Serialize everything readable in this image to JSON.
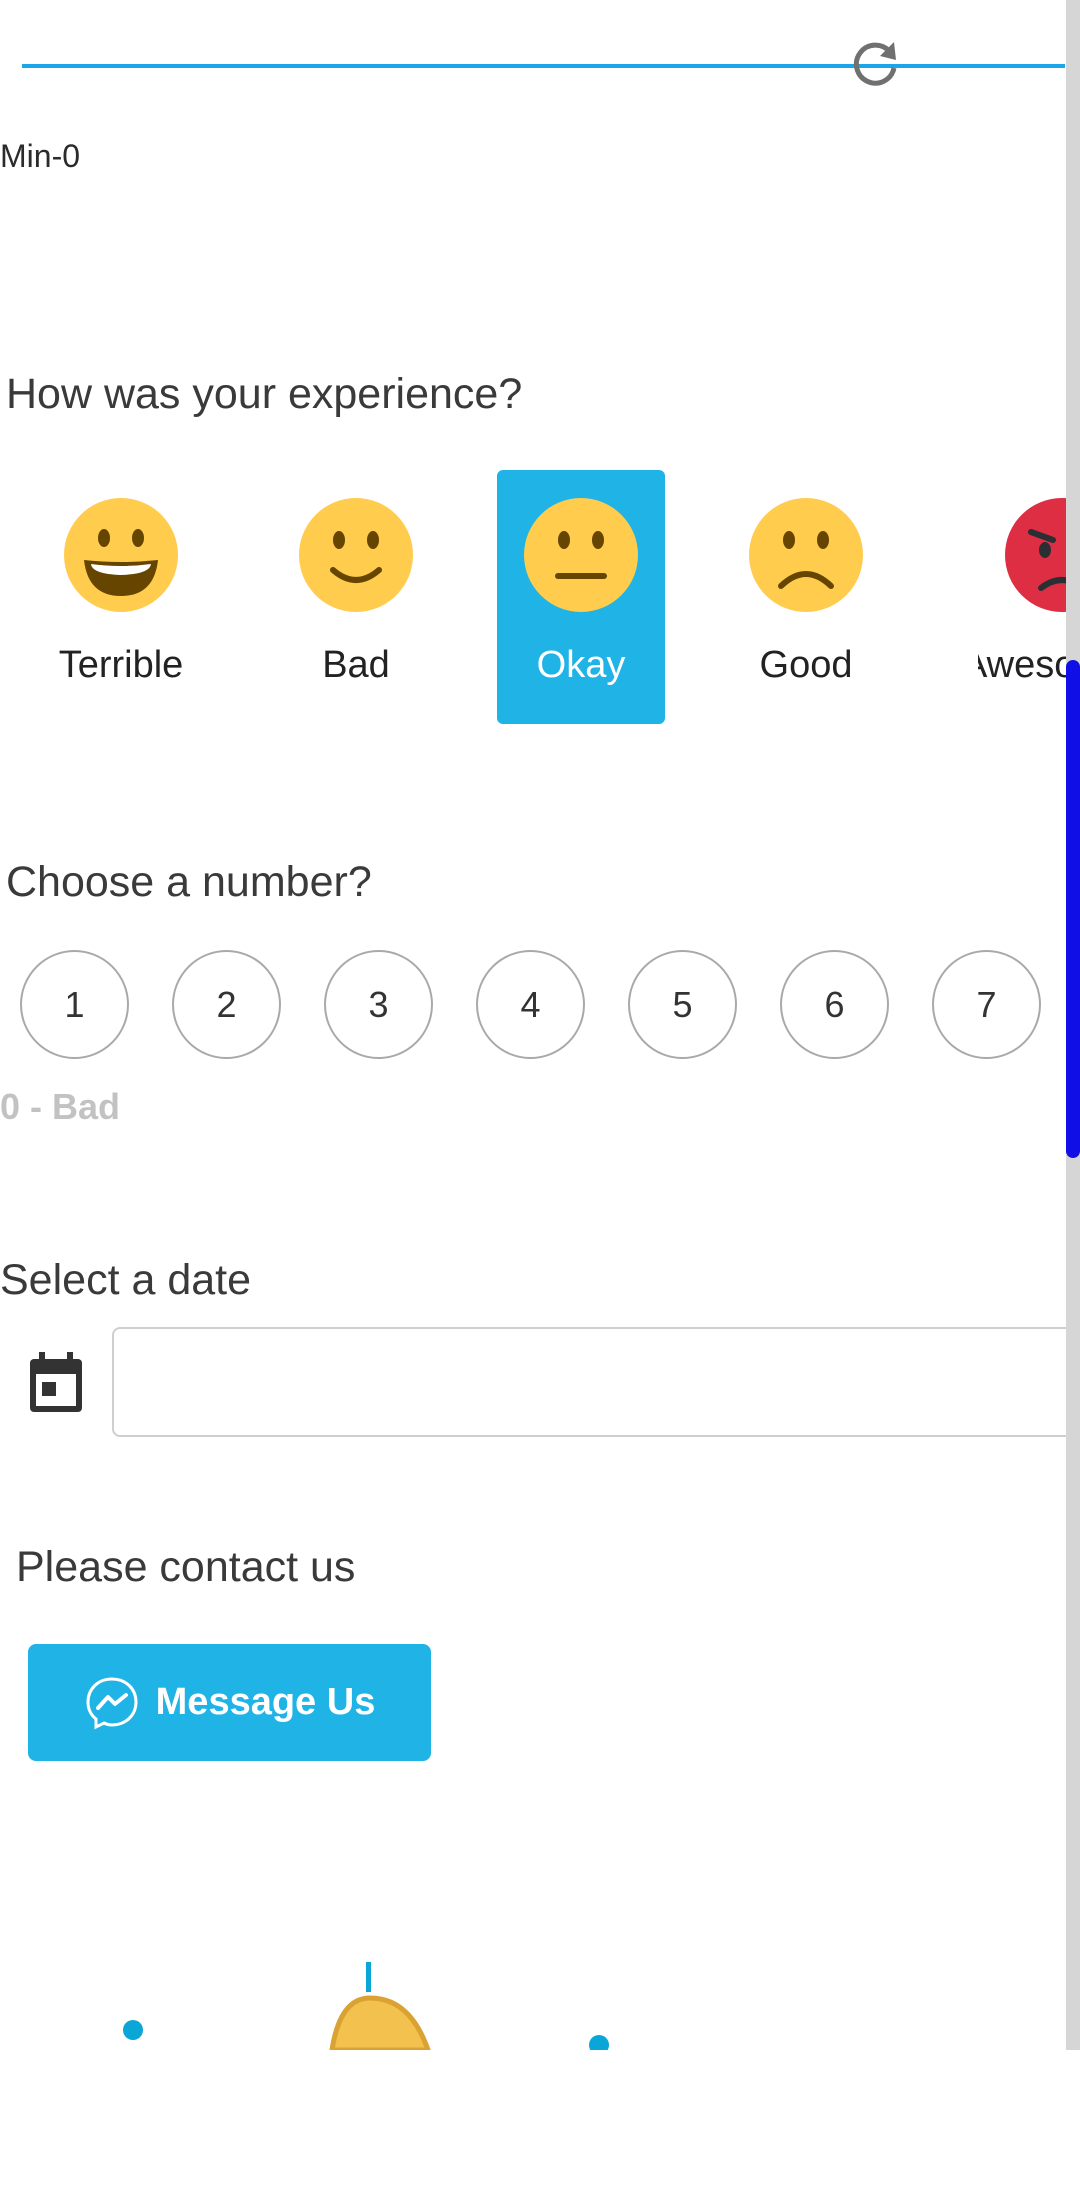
{
  "slider": {
    "min_label": "Min-0"
  },
  "experience": {
    "question": "How was your experience?",
    "options": [
      {
        "label": "Terrible",
        "face": "grinning-face-icon"
      },
      {
        "label": "Bad",
        "face": "slightly-smiling-face-icon"
      },
      {
        "label": "Okay",
        "face": "neutral-face-icon",
        "selected": true
      },
      {
        "label": "Good",
        "face": "frowning-face-icon"
      },
      {
        "label": "Awesome",
        "face": "angry-face-icon"
      }
    ]
  },
  "number": {
    "question": "Choose a number?",
    "options": [
      "1",
      "2",
      "3",
      "4",
      "5",
      "6",
      "7"
    ],
    "caption": "0 - Bad"
  },
  "date": {
    "question": "Select a date",
    "value": "",
    "placeholder": ""
  },
  "contact": {
    "question": "Please contact us",
    "button_label": "Message Us"
  },
  "colors": {
    "accent": "#1FB3E6",
    "emoji_yellow": "#FFCC4D",
    "emoji_red": "#DD2E44",
    "scroll_thumb": "#1010E6"
  }
}
